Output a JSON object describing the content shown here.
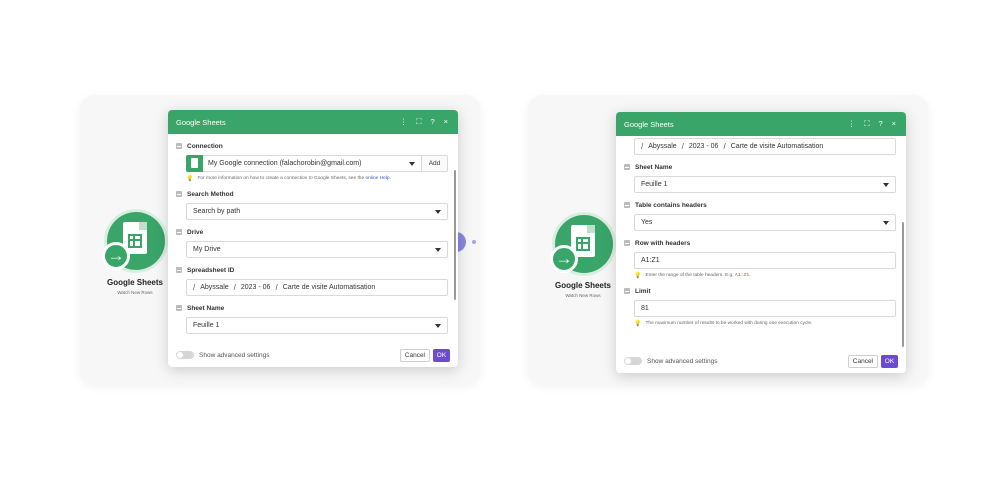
{
  "colors": {
    "brand_green": "#3aa569",
    "accent_purple": "#6c4bd0",
    "link_blue": "#3b58c4"
  },
  "left": {
    "module": {
      "title": "Google Sheets",
      "subtitle": "Watch New Rows"
    },
    "dialog": {
      "title": "Google Sheets",
      "header_icons": [
        "more-vert-icon",
        "expand-icon",
        "help-icon",
        "close-icon"
      ],
      "header_glyphs": {
        "more": "⋮",
        "expand": "⛶",
        "help": "?",
        "close": "×"
      },
      "connection": {
        "label": "Connection",
        "value": "My Google connection (falachorobin@gmail.com)",
        "add_label": "Add",
        "hint_text": "For more information on how to create a connection to Google Sheets, see the",
        "hint_link": "online Help."
      },
      "search_method": {
        "label": "Search Method",
        "value": "Search by path"
      },
      "drive": {
        "label": "Drive",
        "value": "My Drive"
      },
      "spreadsheet_id": {
        "label": "Spreadsheet ID",
        "path": [
          "Abyssale",
          "2023 - 06",
          "Carte de visite Automatisation"
        ]
      },
      "sheet_name": {
        "label": "Sheet Name",
        "value": "Feuille 1"
      },
      "footer": {
        "advanced_label": "Show advanced settings",
        "cancel_label": "Cancel",
        "ok_label": "OK"
      }
    }
  },
  "right": {
    "module": {
      "title": "Google Sheets",
      "subtitle": "Watch New Rows"
    },
    "dialog": {
      "title": "Google Sheets",
      "header_glyphs": {
        "more": "⋮",
        "expand": "⛶",
        "help": "?",
        "close": "×"
      },
      "spreadsheet_path": [
        "Abyssale",
        "2023 - 06",
        "Carte de visite Automatisation"
      ],
      "sheet_name": {
        "label": "Sheet Name",
        "value": "Feuille 1"
      },
      "table_headers": {
        "label": "Table contains headers",
        "value": "Yes"
      },
      "row_with_headers": {
        "label": "Row with headers",
        "value": "A1:Z1",
        "hint_text": "Enter the range of the table headers. E.g.",
        "hint_code": "A1:Z1"
      },
      "limit": {
        "label": "Limit",
        "value": "81",
        "hint_text": "The maximum number of results to be worked with during one execution cycle."
      },
      "footer": {
        "advanced_label": "Show advanced settings",
        "cancel_label": "Cancel",
        "ok_label": "OK"
      }
    }
  }
}
